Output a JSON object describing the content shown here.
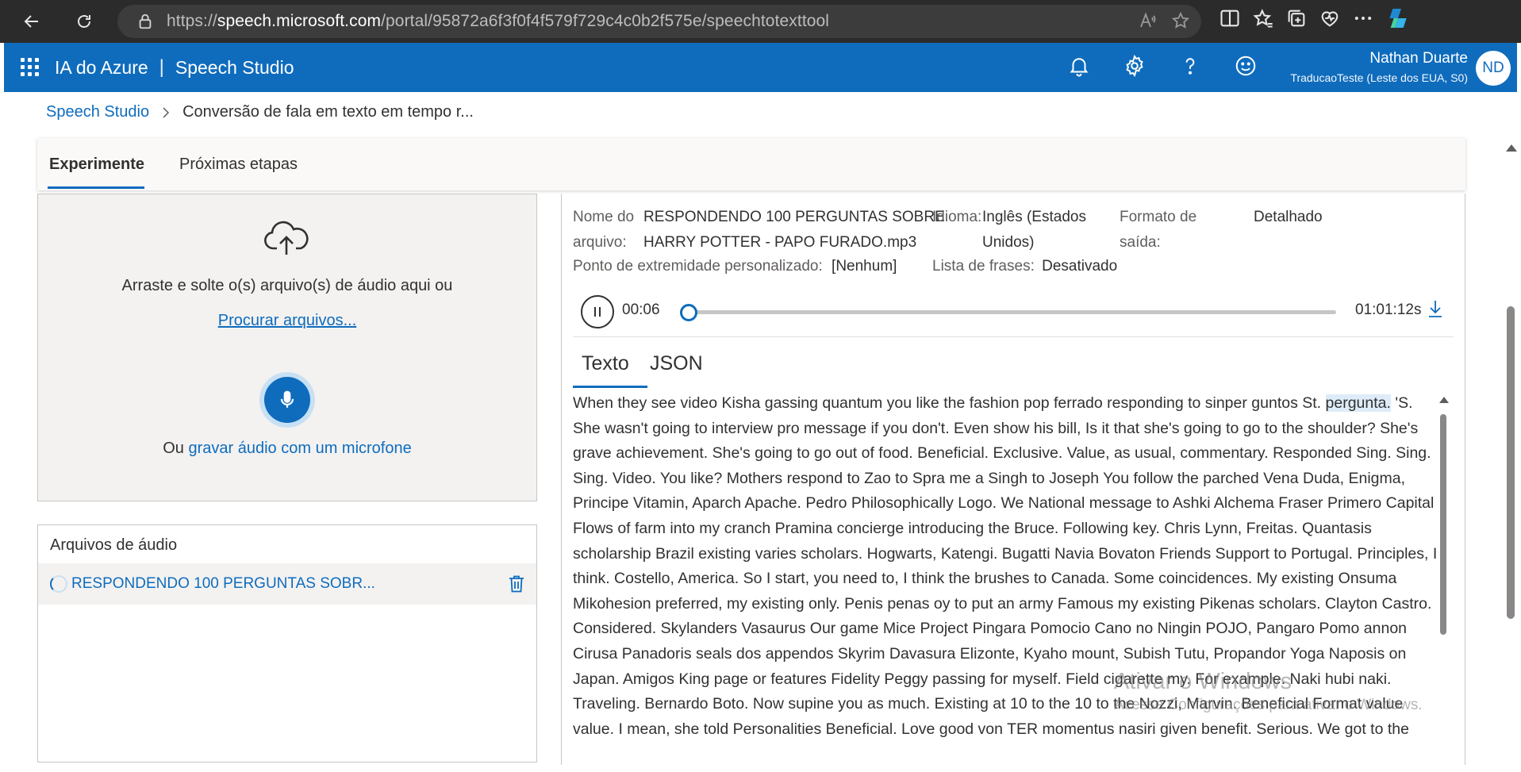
{
  "browser": {
    "url_prefix": "https://",
    "url_host": "speech.microsoft.com",
    "url_path": "/portal/95872a6f3f0f4f579f729c4c0b2f575e/speechtotexttool"
  },
  "header": {
    "product": "IA do Azure",
    "separator": "|",
    "app": "Speech Studio",
    "user_name": "Nathan Duarte",
    "user_sub": "TraducaoTeste (Leste dos EUA, S0)",
    "avatar_initials": "ND",
    "accent_color": "#0f6cbd"
  },
  "breadcrumb": {
    "root": "Speech Studio",
    "current": "Conversão de fala em texto em tempo r..."
  },
  "tabs": [
    "Experimente",
    "Próximas etapas"
  ],
  "upload": {
    "drop_text": "Arraste e solte o(s) arquivo(s) de áudio aqui ou",
    "browse": "Procurar arquivos...",
    "record_prefix": "Ou",
    "record_link": "gravar áudio com um microfone"
  },
  "files": {
    "title": "Arquivos de áudio",
    "items": [
      {
        "name": "RESPONDENDO 100 PERGUNTAS SOBR..."
      }
    ]
  },
  "details": {
    "file_label_1": "Nome do",
    "file_label_2": "arquivo:",
    "file_value_1": "RESPONDENDO 100 PERGUNTAS SOBRE",
    "file_value_2": "HARRY POTTER - PAPO FURADO.mp3",
    "lang_label": "Idioma:",
    "lang_value_1": "Inglês (Estados",
    "lang_value_2": "Unidos)",
    "format_label_1": "Formato de",
    "format_label_2": "saída:",
    "format_value": "Detalhado",
    "endpoint_label": "Ponto de extremidade personalizado:",
    "endpoint_value": "[Nenhum]",
    "phrase_label": "Lista de frases:",
    "phrase_value": "Desativado"
  },
  "player": {
    "current_time": "00:06",
    "total_time": "01:01:12s",
    "progress": 0.0017
  },
  "result_tabs": [
    "Texto",
    "JSON"
  ],
  "transcript": {
    "before_highlight": "When they see video Kisha gassing quantum you like the fashion pop ferrado responding to sinper guntos St. ",
    "highlight": "pergunta.",
    "after_highlight": " 'S. She wasn't going to interview pro message if you don't. Even show his bill, Is it that she's going to go to the shoulder? She's grave achievement. She's going to go out of food. Beneficial. Exclusive. Value, as usual, commentary. Responded Sing. Sing. Sing. Video. You like? Mothers respond to Zao to Spra me a Singh to Joseph You follow the parched Vena Duda, Enigma, Principe Vitamin, Aparch Apache. Pedro Philosophically Logo. We National message to Ashki Alchema Fraser Primero Capital Flows of farm into my cranch Pramina concierge introducing the Bruce. Following key. Chris Lynn, Freitas. Quantasis scholarship Brazil existing varies scholars. Hogwarts, Katengi. Bugatti Navia Bovaton Friends Support to Portugal. Principles, I think. Costello, America. So I start, you need to, I think the brushes to Canada. Some coincidences. My existing Onsuma Mikohesion preferred, my existing only. Penis penas oy to put an army Famous my existing Pikenas scholars. Clayton Castro. Considered. Skylanders Vasaurus Our game Mice Project Pingara Pomocio Cano no Ningin POJO, Pangaro Pomo annon Cirusa Panadoris seals dos appendos Skyrim Davasura Elizonte, Kyaho mount, Subish Tutu, Propandor Yoga Naposis on Japan. Amigos King page or features Fidelity Peggy passing for myself. Field cigarette my. For example. Naki hubi naki. Traveling. Bernardo Boto. Now supine you as much. Existing at 10 to the 10 to the Nozzi, Marvin. Beneficial Format value value. I mean, she told Personalities Beneficial. Love good von TER momentus nasiri given benefit. Serious. We got to the"
  },
  "watermark": {
    "line1": "Ativar o Windows",
    "line2": "Acesse Configurações para ativar o Windows."
  }
}
